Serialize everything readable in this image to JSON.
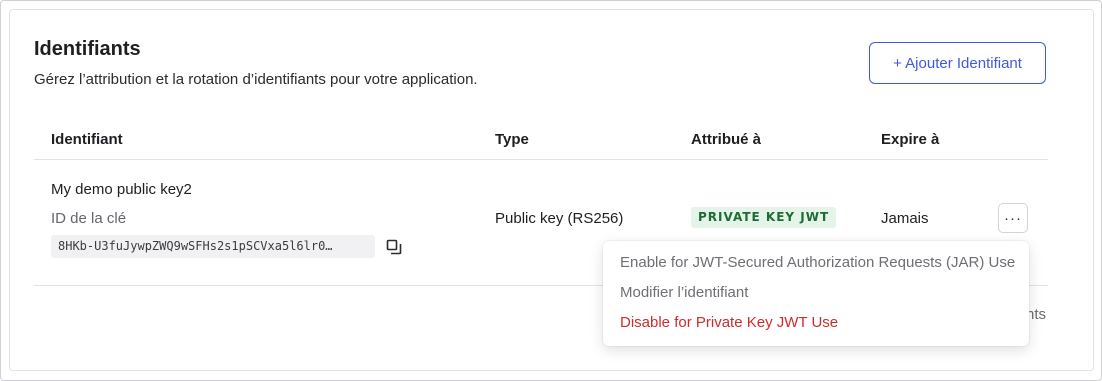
{
  "section": {
    "title": "Identifiants",
    "subtitle": "Gérez l’attribution et la rotation d’identifiants pour votre application.",
    "add_button_label": "+ Ajouter Identifiant"
  },
  "table": {
    "headers": [
      "Identifiant",
      "Type",
      "Attribué à",
      "Expire à"
    ],
    "rows": [
      {
        "name": "My demo public key2",
        "key_id_label": "ID de la clé",
        "key_id_value": "8HKb-U3fuJywpZWQ9wSFHs2s1pSCVxa5l6lr0…",
        "type": "Public key (RS256)",
        "assigned_to": "PRIVATE KEY JWT",
        "expires": "Jamais",
        "actions_label": "···"
      }
    ]
  },
  "hidden_text_fragment": "nts",
  "menu": {
    "items": [
      {
        "label": "Enable for JWT-Secured Authorization Requests (JAR) Use"
      },
      {
        "label": "Modifier l’identifiant"
      },
      {
        "label": "Disable for Private Key JWT Use"
      }
    ]
  },
  "colors": {
    "accent": "#3f59e4",
    "badge_bg": "#e5f4e8",
    "badge_text": "#1e6b34",
    "danger": "#d12a2a"
  },
  "icons": {
    "copy": "copy-icon",
    "more": "more-horizontal-icon"
  }
}
